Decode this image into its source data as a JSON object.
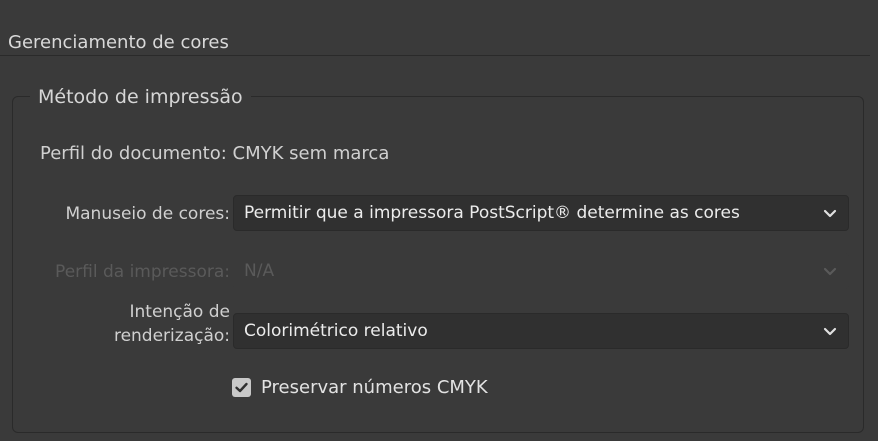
{
  "panel": {
    "title": "Gerenciamento de cores"
  },
  "print_method": {
    "title": "Método de impressão",
    "document_profile": "Perfil do documento: CMYK sem marca",
    "color_handling": {
      "label": "Manuseio de cores:",
      "value": "Permitir que a impressora PostScript® determine as cores"
    },
    "printer_profile": {
      "label": "Perfil da impressora:",
      "value": "N/A",
      "enabled": false
    },
    "rendering_intent": {
      "label_line1": "Intenção de",
      "label_line2": "renderização:",
      "value": "Colorimétrico relativo"
    },
    "preserve_cmyk": {
      "label": "Preservar números CMYK",
      "checked": true
    }
  },
  "icons": {
    "dropdown": "chevron-down-icon",
    "check": "checkmark-icon"
  },
  "colors": {
    "background": "#3a3a3a",
    "field_background": "#303030",
    "text": "#d6d6d6",
    "disabled_text": "#5a5a5a"
  }
}
